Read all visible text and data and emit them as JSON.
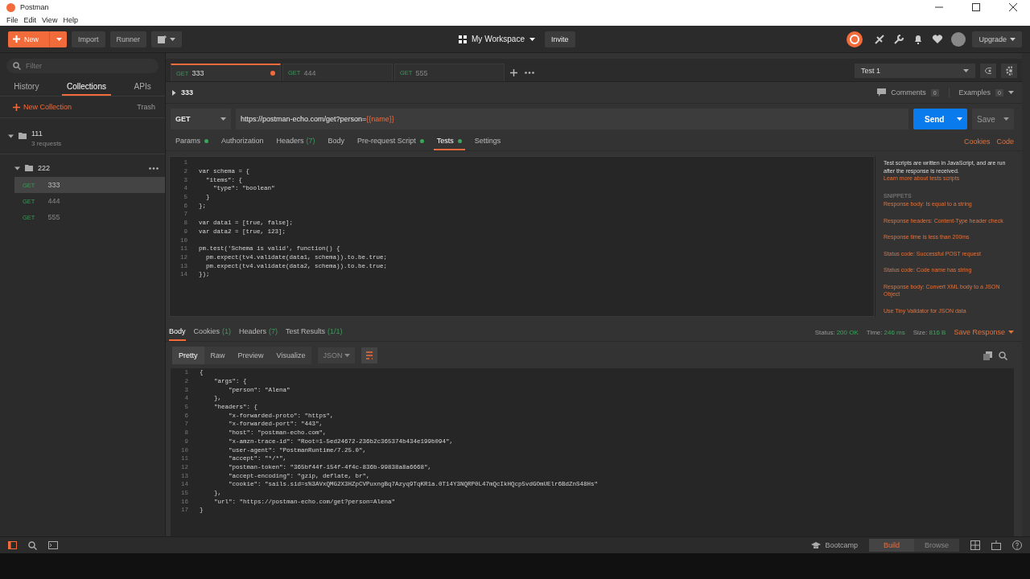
{
  "window": {
    "title": "Postman"
  },
  "menu": [
    "File",
    "Edit",
    "View",
    "Help"
  ],
  "toolbar": {
    "new": "New",
    "import": "Import",
    "runner": "Runner",
    "workspace": "My Workspace",
    "invite": "Invite",
    "upgrade": "Upgrade"
  },
  "sidebar": {
    "filter_placeholder": "Filter",
    "tabs": [
      {
        "label": "History",
        "selected": false
      },
      {
        "label": "Collections",
        "selected": true
      },
      {
        "label": "APIs",
        "selected": false
      }
    ],
    "new_collection": "New Collection",
    "trash": "Trash",
    "collections": [
      {
        "name": "111",
        "meta": "3 requests",
        "expanded": true,
        "children": [
          {
            "name": "222",
            "expanded": true,
            "children": [
              {
                "method": "GET",
                "name": "333",
                "selected": true
              },
              {
                "method": "GET",
                "name": "444",
                "selected": false
              },
              {
                "method": "GET",
                "name": "555",
                "selected": false
              }
            ]
          }
        ]
      }
    ]
  },
  "request_tabs": [
    {
      "method": "GET",
      "name": "333",
      "selected": true,
      "unsaved": true
    },
    {
      "method": "GET",
      "name": "444",
      "selected": false,
      "unsaved": false
    },
    {
      "method": "GET",
      "name": "555",
      "selected": false,
      "unsaved": false
    }
  ],
  "environment": "Test 1",
  "request": {
    "name": "333",
    "comments": {
      "label": "Comments",
      "count": "0"
    },
    "examples": {
      "label": "Examples",
      "count": "0"
    },
    "method": "GET",
    "url": "https://postman-echo.com/get?person=",
    "url_variable": "{{name}}",
    "send": "Send",
    "save": "Save",
    "tabs": [
      {
        "label": "Params",
        "indicator": true,
        "selected": false
      },
      {
        "label": "Authorization",
        "indicator": false,
        "selected": false
      },
      {
        "label": "Headers",
        "count": "(7)",
        "indicator": false,
        "selected": false
      },
      {
        "label": "Body",
        "indicator": false,
        "selected": false
      },
      {
        "label": "Pre-request Script",
        "indicator": true,
        "selected": false
      },
      {
        "label": "Tests",
        "indicator": true,
        "selected": true
      },
      {
        "label": "Settings",
        "indicator": false,
        "selected": false
      }
    ],
    "links": [
      "Cookies",
      "Code"
    ]
  },
  "editor": {
    "lines": [
      {
        "number": "1"
      },
      {
        "number": "2",
        "code": "var schema = {"
      },
      {
        "number": "3",
        "code": "  \"items\": {"
      },
      {
        "number": "4",
        "code": "    \"type\": \"boolean\""
      },
      {
        "number": "5",
        "code": "  }"
      },
      {
        "number": "6",
        "code": "};"
      },
      {
        "number": "7"
      },
      {
        "number": "8",
        "code": "var data1 = [true, false];"
      },
      {
        "number": "9",
        "code": "var data2 = [true, 123];"
      },
      {
        "number": "10"
      },
      {
        "number": "11",
        "code": "pm.test('Schema is valid', function() {"
      },
      {
        "number": "12",
        "code": "  pm.expect(tv4.validate(data1, schema)).to.be.true;"
      },
      {
        "number": "13",
        "code": "  pm.expect(tv4.validate(data2, schema)).to.be.true;"
      },
      {
        "number": "14",
        "code": "});"
      }
    ]
  },
  "snippets_panel": {
    "intro": "Test scripts are written in JavaScript, and are run after the response is received.",
    "link": "Learn more about tests scripts",
    "heading": "SNIPPETS",
    "items": [
      "Response body: Is equal to a string",
      "Response headers: Content-Type header check",
      "Response time is less than 200ms",
      "Status code: Successful POST request",
      "Status code: Code name has string",
      "Response body: Convert XML body to a JSON Object",
      "Use Tiny Validator for JSON data"
    ]
  },
  "response": {
    "tabs": [
      {
        "label": "Body",
        "selected": true
      },
      {
        "label": "Cookies",
        "count": "(1)",
        "selected": false
      },
      {
        "label": "Headers",
        "count": "(7)",
        "selected": false
      },
      {
        "label": "Test Results",
        "count": "(1/1)",
        "selected": false
      }
    ],
    "stats": [
      {
        "label": "Status:",
        "value": "200 OK"
      },
      {
        "label": "Time:",
        "value": "246 ms"
      },
      {
        "label": "Size:",
        "value": "816 B"
      }
    ],
    "save": "Save Response",
    "views": [
      {
        "label": "Pretty",
        "selected": true
      },
      {
        "label": "Raw",
        "selected": false
      },
      {
        "label": "Preview",
        "selected": false
      },
      {
        "label": "Visualize",
        "selected": false
      }
    ],
    "format": "JSON",
    "lines": [
      {
        "number": "1",
        "code": "{"
      },
      {
        "number": "2",
        "code": "    \"args\": {"
      },
      {
        "number": "3",
        "code": "        \"person\": \"Alena\""
      },
      {
        "number": "4",
        "code": "    },"
      },
      {
        "number": "5",
        "code": "    \"headers\": {"
      },
      {
        "number": "6",
        "code": "        \"x-forwarded-proto\": \"https\","
      },
      {
        "number": "7",
        "code": "        \"x-forwarded-port\": \"443\","
      },
      {
        "number": "8",
        "code": "        \"host\": \"postman-echo.com\","
      },
      {
        "number": "9",
        "code": "        \"x-amzn-trace-id\": \"Root=1-5ed24672-236b2c365374b434e199b094\","
      },
      {
        "number": "10",
        "code": "        \"user-agent\": \"PostmanRuntime/7.25.0\","
      },
      {
        "number": "11",
        "code": "        \"accept\": \"*/*\","
      },
      {
        "number": "12",
        "code": "        \"postman-token\": \"365bf44f-154f-4f4c-836b-99838a8a6668\","
      },
      {
        "number": "13",
        "code": "        \"accept-encoding\": \"gzip, deflate, br\","
      },
      {
        "number": "14",
        "code": "        \"cookie\": \"sails.sid=s%3AVxQMG2X3HZpCVPuxngBq7Azyq9TqKR1a.0T14Y3NQRP0L47mQcIkHQcp5vdGOmUElr6BdZnS48Hs\""
      },
      {
        "number": "15",
        "code": "    },"
      },
      {
        "number": "16",
        "code": "    \"url\": \"https://postman-echo.com/get?person=Alena\""
      },
      {
        "number": "17",
        "code": "}"
      }
    ]
  },
  "status_bar": {
    "bootcamp": "Bootcamp",
    "modes": [
      {
        "label": "Build",
        "selected": true
      },
      {
        "label": "Browse",
        "selected": false
      }
    ]
  }
}
